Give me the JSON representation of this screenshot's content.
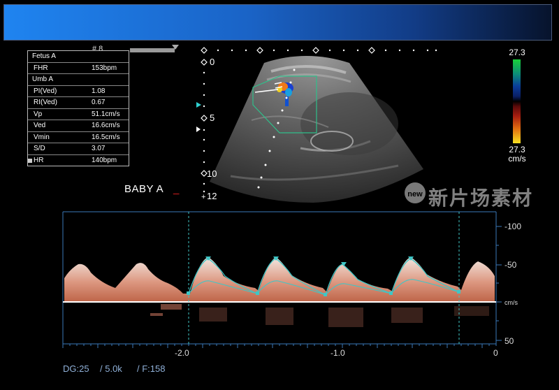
{
  "header": {
    "marker_label": "# 8"
  },
  "measurements": {
    "rows": [
      {
        "label": "Fetus A",
        "value": ""
      },
      {
        "label": "FHR",
        "value": "153bpm"
      },
      {
        "label": "Umb A",
        "value": ""
      },
      {
        "label": "PI(Ved)",
        "value": "1.08"
      },
      {
        "label": "RI(Ved)",
        "value": "0.67"
      },
      {
        "label": "Vp",
        "value": "51.1cm/s"
      },
      {
        "label": "Ved",
        "value": "16.6cm/s"
      },
      {
        "label": "Vmin",
        "value": "16.5cm/s"
      },
      {
        "label": "S/D",
        "value": "3.07"
      },
      {
        "label": "HR",
        "value": "140bpm"
      }
    ]
  },
  "annotation": {
    "text": "BABY A",
    "cursor": "_"
  },
  "depth_scale": {
    "d0": "0",
    "d5": "5",
    "d10": "10",
    "d12": "12"
  },
  "color_scale": {
    "top": "27.3",
    "bottom": "27.3",
    "unit": "cm/s",
    "top_color": "#19d23a",
    "bottom_color": "#f8e020"
  },
  "watermark": {
    "text": "新片场素材",
    "badge": "new"
  },
  "spectral": {
    "velocity_labels": {
      "v_neg100": "-100",
      "v_neg50": "-50",
      "unit": "cm/s",
      "v_50": "50"
    },
    "time_labels": {
      "t_neg2": "-2.0",
      "t_neg1": "-1.0",
      "t_0": "0"
    },
    "trace_color": "#3fc6c6",
    "spectrum_color": "#f0b49a"
  },
  "settings": {
    "dg": "DG:25",
    "prf": "/ 5.0k",
    "filter": "/ F:158"
  }
}
